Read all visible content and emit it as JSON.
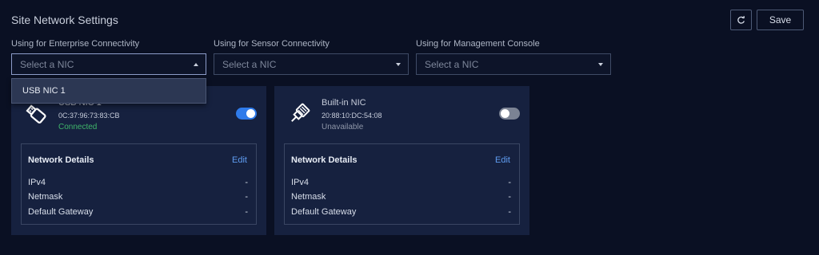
{
  "header": {
    "title": "Site Network Settings",
    "save_label": "Save",
    "refresh_icon": "refresh-icon"
  },
  "selects": [
    {
      "label": "Using for Enterprise Connectivity",
      "placeholder": "Select a NIC",
      "open": true
    },
    {
      "label": "Using for Sensor Connectivity",
      "placeholder": "Select a NIC",
      "open": false
    },
    {
      "label": "Using for Management Console",
      "placeholder": "Select a NIC",
      "open": false
    }
  ],
  "dropdown": {
    "options": [
      "USB NIC 1"
    ]
  },
  "cards": [
    {
      "name": "USB NIC 1",
      "mac": "0C:37:96:73:83:CB",
      "status": "Connected",
      "enabled": true,
      "icon": "usb-icon",
      "details": {
        "title": "Network Details",
        "edit_label": "Edit",
        "rows": [
          {
            "label": "IPv4",
            "value": "-"
          },
          {
            "label": "Netmask",
            "value": "-"
          },
          {
            "label": "Default Gateway",
            "value": "-"
          }
        ]
      }
    },
    {
      "name": "Built-in NIC",
      "mac": "20:88:10:DC:54:08",
      "status": "Unavailable",
      "enabled": false,
      "icon": "ethernet-plug-icon",
      "details": {
        "title": "Network Details",
        "edit_label": "Edit",
        "rows": [
          {
            "label": "IPv4",
            "value": "-"
          },
          {
            "label": "Netmask",
            "value": "-"
          },
          {
            "label": "Default Gateway",
            "value": "-"
          }
        ]
      }
    }
  ],
  "colors": {
    "background": "#0a1023",
    "card": "#16213f",
    "accent": "#2f7bea",
    "link": "#5f9cf0",
    "connected": "#3fb56a"
  }
}
